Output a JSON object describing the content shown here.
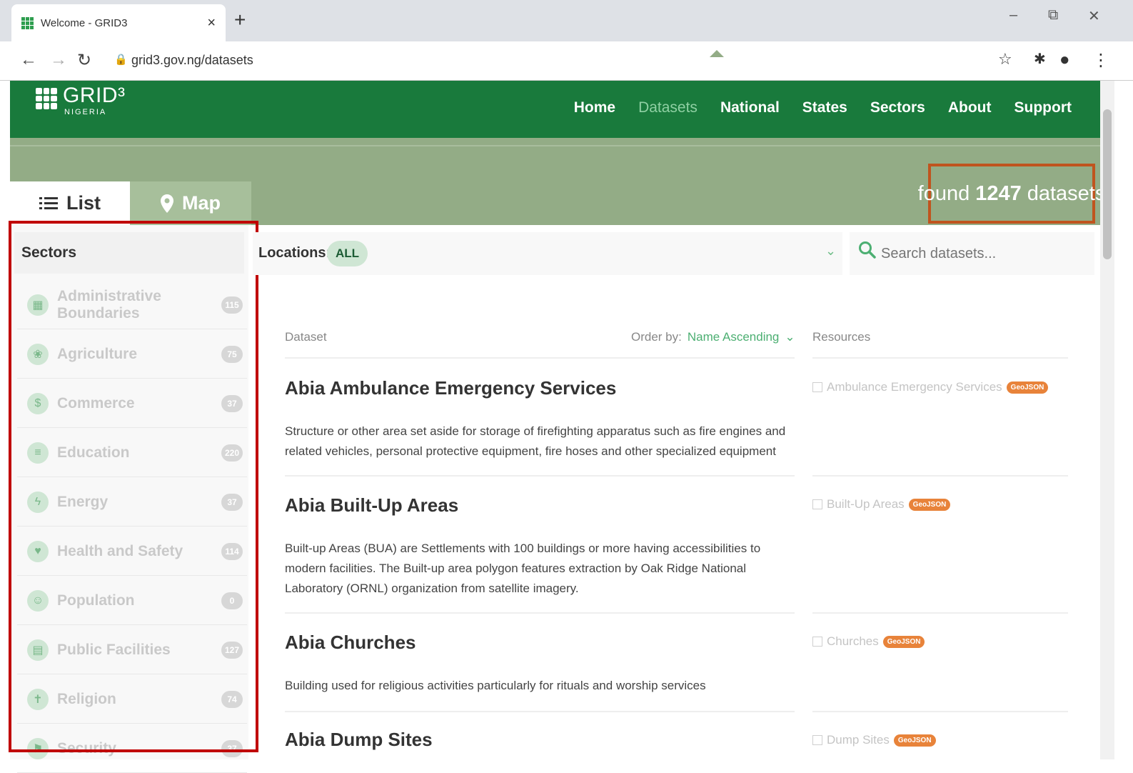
{
  "browser": {
    "tab_title": "Welcome - GRID3",
    "tab_close": "×",
    "new_tab": "+",
    "url": "grid3.gov.ng/datasets",
    "window_controls": {
      "minimize": "–",
      "restore": "⧉",
      "close": "✕"
    }
  },
  "site": {
    "logo_text": "GRID³",
    "logo_sub": "NIGERIA",
    "nav": [
      {
        "label": "Home",
        "active": false
      },
      {
        "label": "Datasets",
        "active": true
      },
      {
        "label": "National",
        "active": false
      },
      {
        "label": "States",
        "active": false
      },
      {
        "label": "Sectors",
        "active": false
      },
      {
        "label": "About",
        "active": false
      },
      {
        "label": "Support",
        "active": false
      }
    ]
  },
  "view_tabs": {
    "list": "List",
    "map": "Map"
  },
  "found": {
    "prefix": "found",
    "count": "1247",
    "suffix": "datasets"
  },
  "sidebar": {
    "title": "Sectors",
    "items": [
      {
        "label": "Administrative Boundaries",
        "count": "115"
      },
      {
        "label": "Agriculture",
        "count": "75"
      },
      {
        "label": "Commerce",
        "count": "37"
      },
      {
        "label": "Education",
        "count": "220"
      },
      {
        "label": "Energy",
        "count": "37"
      },
      {
        "label": "Health and Safety",
        "count": "114"
      },
      {
        "label": "Population",
        "count": "0"
      },
      {
        "label": "Public Facilities",
        "count": "127"
      },
      {
        "label": "Religion",
        "count": "74"
      },
      {
        "label": "Security",
        "count": "37"
      }
    ]
  },
  "filters": {
    "locations_label": "Locations:",
    "locations_value": "ALL",
    "search_placeholder": "Search datasets..."
  },
  "list_header": {
    "dataset": "Dataset",
    "order_by_label": "Order by:",
    "order_by_value": "Name Ascending",
    "resources": "Resources"
  },
  "datasets": [
    {
      "title": "Abia Ambulance Emergency Services",
      "description": "Structure or other area set aside for storage of firefighting apparatus such as fire engines and related vehicles, personal protective equipment, fire hoses and other specialized equipment",
      "resource": "Ambulance Emergency Services",
      "format": "GeoJSON"
    },
    {
      "title": "Abia Built-Up Areas",
      "description": "Built-up Areas (BUA) are Settlements with 100 buildings or more having accessibilities to modern facilities. The Built-up area polygon features extraction by Oak Ridge National Laboratory (ORNL) organization from satellite imagery.",
      "resource": "Built-Up Areas",
      "format": "GeoJSON"
    },
    {
      "title": "Abia Churches",
      "description": "Building used for religious activities particularly for rituals and worship services",
      "resource": "Churches",
      "format": "GeoJSON"
    },
    {
      "title": "Abia Dump Sites",
      "description": "",
      "resource": "Dump Sites",
      "format": "GeoJSON"
    }
  ],
  "colors": {
    "header_green": "#197a3c",
    "band_olive": "#93ac86",
    "highlight_red": "#c00000",
    "found_border": "#c0541e",
    "accent_green": "#4caf72"
  }
}
